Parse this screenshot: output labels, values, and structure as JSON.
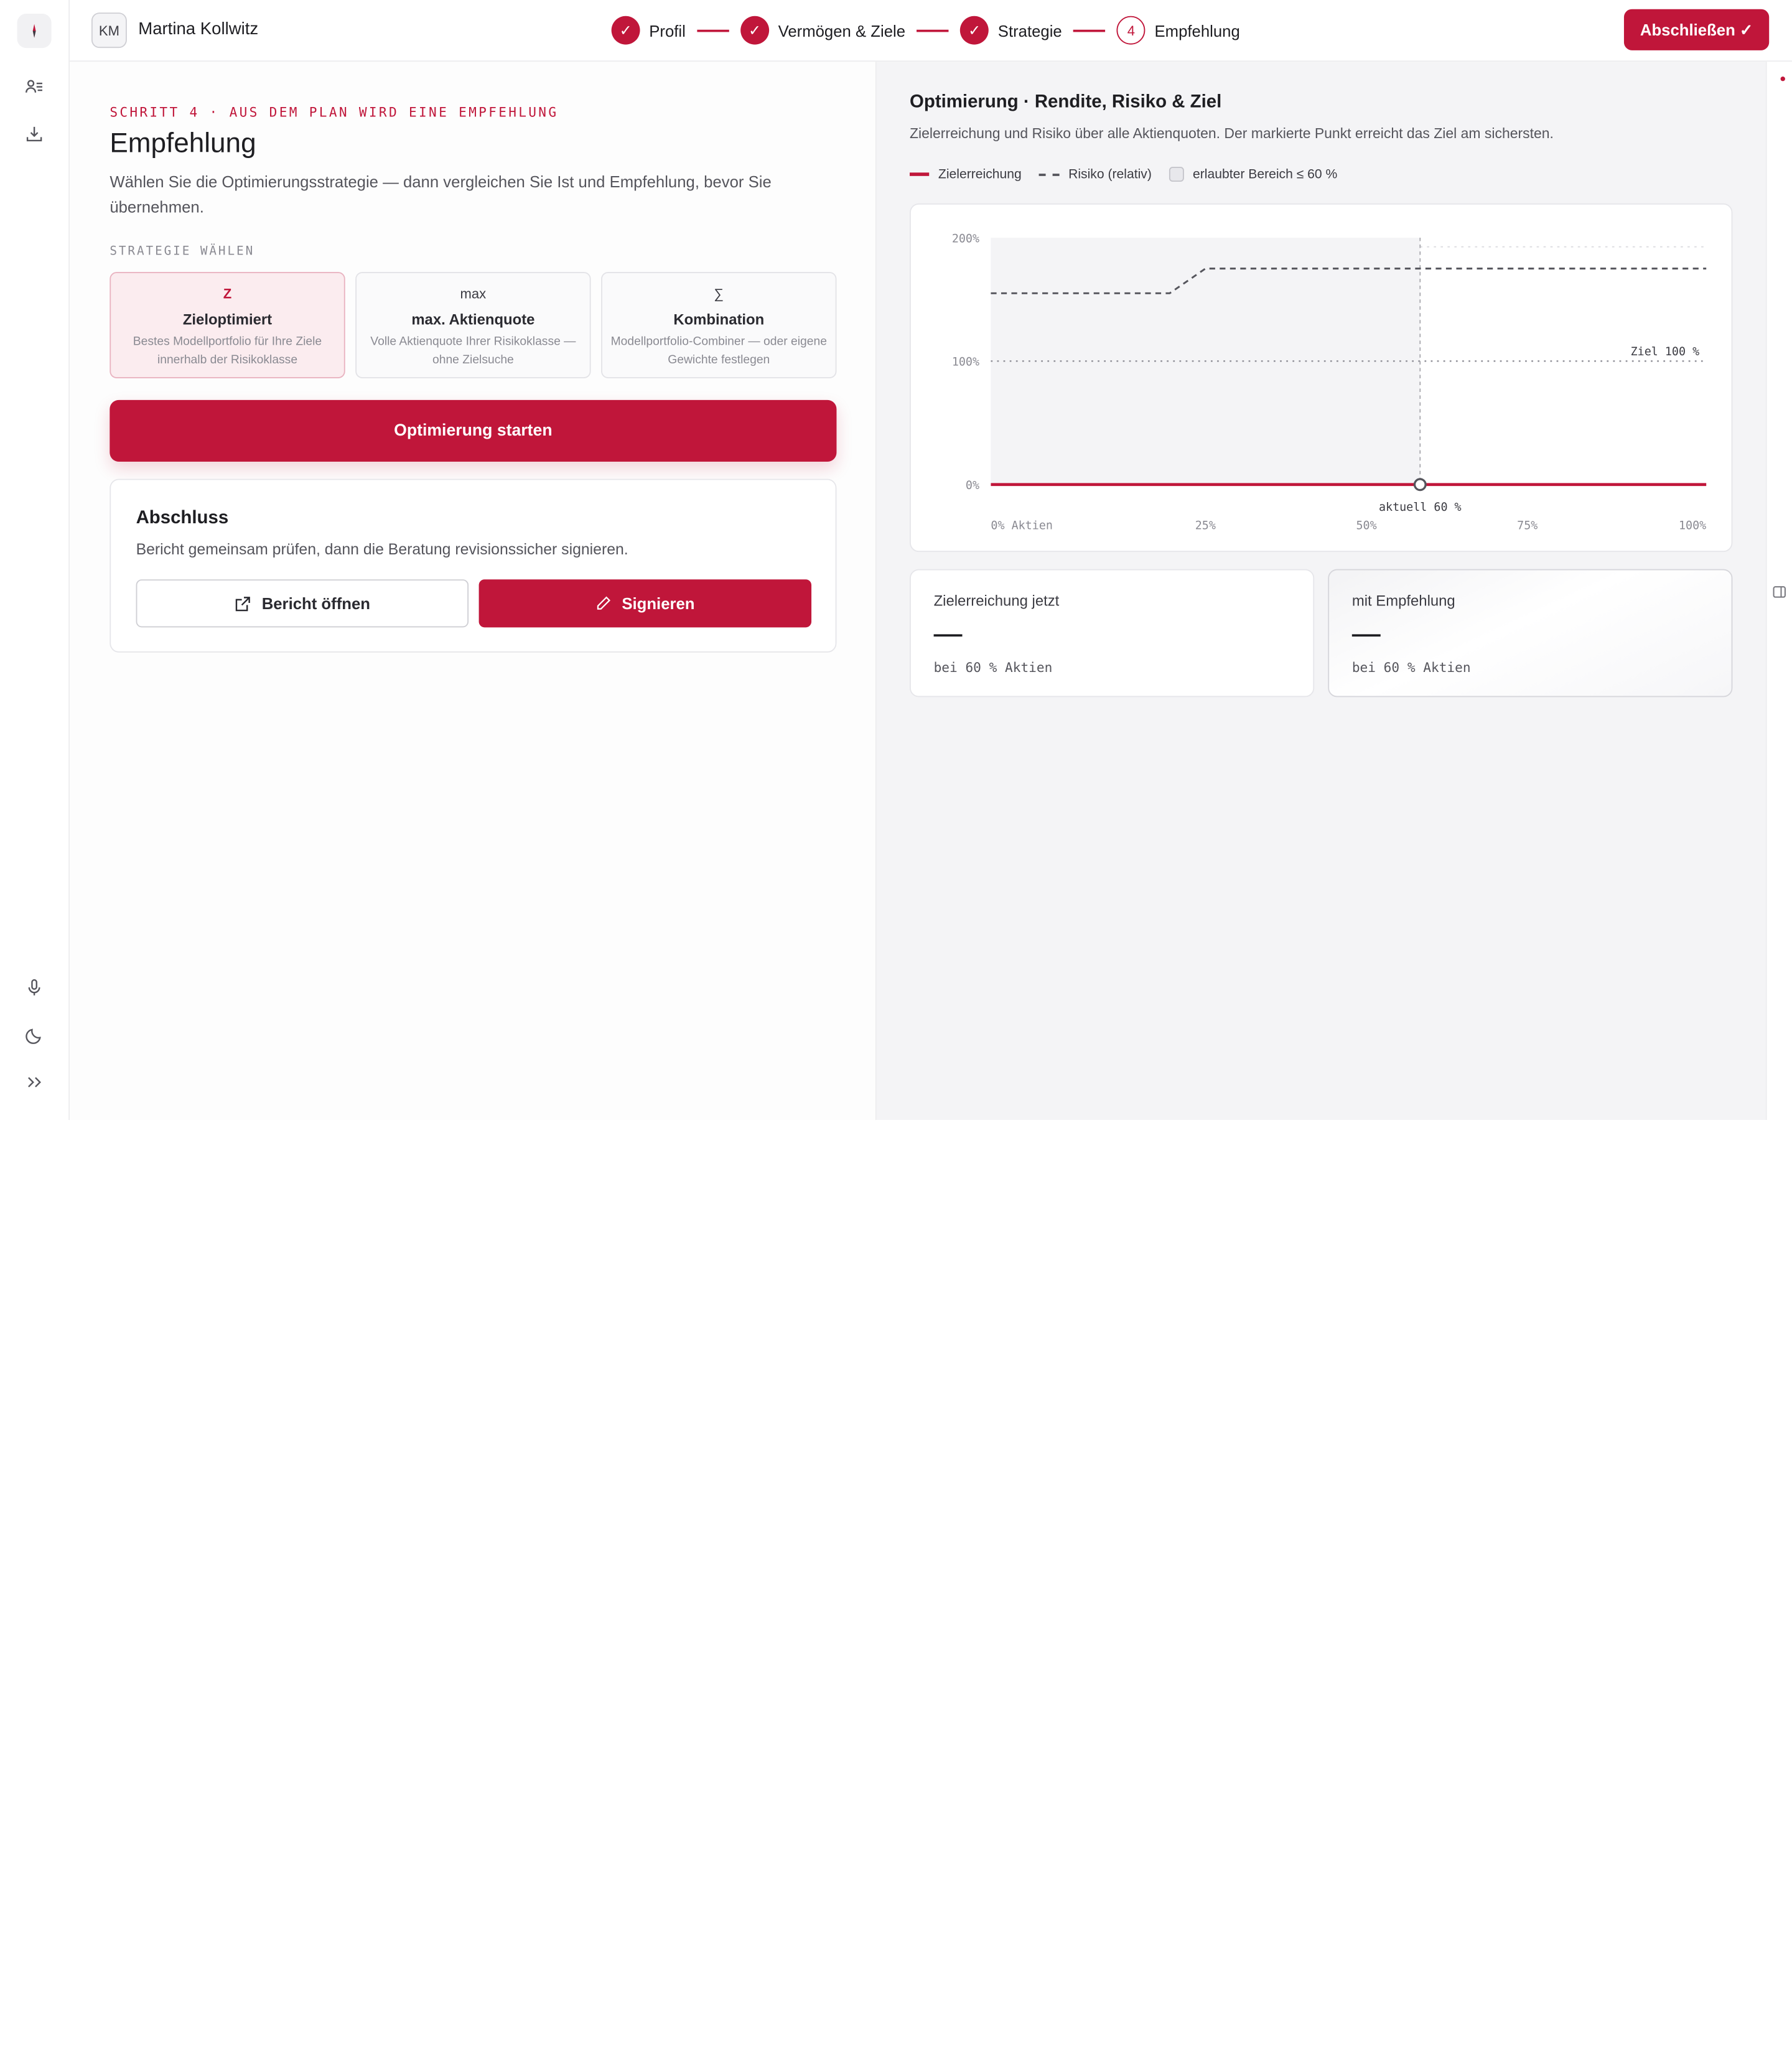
{
  "colors": {
    "accent": "#c0163a",
    "accent_soft": "#fbecef",
    "panel": "#f4f4f6"
  },
  "rail": {
    "icons": [
      "compass-icon",
      "users-list-icon",
      "download-icon",
      "microphone-icon",
      "moon-icon",
      "chevrons-right-icon"
    ]
  },
  "header": {
    "avatar_initials": "KM",
    "client_name": "Martina Kollwitz",
    "steps": [
      {
        "label": "Profil",
        "state": "done",
        "marker": "✓"
      },
      {
        "label": "Vermögen & Ziele",
        "state": "done",
        "marker": "✓"
      },
      {
        "label": "Strategie",
        "state": "done",
        "marker": "✓"
      },
      {
        "label": "Empfehlung",
        "state": "current",
        "marker": "4"
      }
    ],
    "finish_label": "Abschließen ✓"
  },
  "left": {
    "eyebrow": "SCHRITT 4 · AUS DEM PLAN WIRD EINE EMPFEHLUNG",
    "title": "Empfehlung",
    "subtitle": "Wählen Sie die Optimierungsstrategie — dann vergleichen Sie Ist und Empfehlung, bevor Sie übernehmen.",
    "section_label": "STRATEGIE WÄHLEN",
    "strategies": [
      {
        "icon": "Z",
        "name": "Zieloptimiert",
        "desc": "Bestes Modellportfolio für Ihre Ziele innerhalb der Risikoklasse",
        "selected": true
      },
      {
        "icon": "max",
        "name": "max. Aktienquote",
        "desc": "Volle Aktienquote Ihrer Risikoklasse — ohne Zielsuche",
        "selected": false
      },
      {
        "icon": "∑",
        "name": "Kombination",
        "desc": "Modellportfolio-Combiner — oder eigene Gewichte festlegen",
        "selected": false
      }
    ],
    "optimize_label": "Optimierung starten",
    "closing": {
      "title": "Abschluss",
      "text": "Bericht gemeinsam prüfen, dann die Beratung revisionssicher signieren.",
      "open_report": "Bericht öffnen",
      "sign": "Signieren"
    }
  },
  "right": {
    "title": "Optimierung · Rendite, Risiko & Ziel",
    "subtitle": "Zielerreichung und Risiko über alle Aktienquoten. Der markierte Punkt erreicht das Ziel am sichersten.",
    "legend": {
      "goal": "Zielerreichung",
      "risk": "Risiko (relativ)",
      "allowed": "erlaubter Bereich ≤ 60 %"
    },
    "metrics": [
      {
        "label": "Zielerreichung jetzt",
        "value": "—",
        "sub": "bei 60 % Aktien"
      },
      {
        "label": "mit Empfehlung",
        "value": "—",
        "sub": "bei 60 % Aktien"
      }
    ]
  },
  "chart_data": {
    "type": "line",
    "x_label_ticks": [
      "0% Aktien",
      "25%",
      "50%",
      "75%",
      "100%"
    ],
    "y_ticks": [
      "200%",
      "100%",
      "0%"
    ],
    "xlim": [
      0,
      100
    ],
    "ylim": [
      0,
      200
    ],
    "series": [
      {
        "name": "Zielerreichung",
        "style": "solid",
        "color": "#c0163a",
        "x": [
          0,
          100
        ],
        "y": [
          0,
          0
        ]
      },
      {
        "name": "Risiko (relativ)",
        "style": "dashed",
        "color": "#55555c",
        "x": [
          0,
          25,
          30,
          100
        ],
        "y": [
          155,
          155,
          175,
          175
        ]
      }
    ],
    "target": {
      "y": 100,
      "label": "Ziel 100 %"
    },
    "allowed_range": {
      "x_max": 60
    },
    "current": {
      "x": 60,
      "y": 0,
      "label": "aktuell 60 %"
    },
    "grid": false
  }
}
